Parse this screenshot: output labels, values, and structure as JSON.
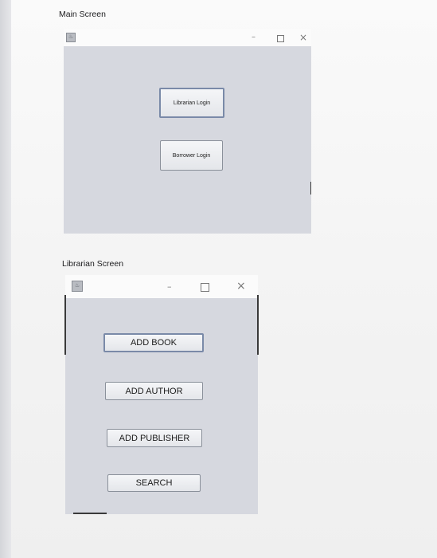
{
  "main_screen": {
    "caption": "Main Screen",
    "buttons": {
      "librarian_login": "Librarian Login",
      "borrower_login": "Borrower Login"
    },
    "window_controls": {
      "minimize": "–",
      "close": "×"
    }
  },
  "librarian_screen": {
    "caption": "Librarian Screen",
    "buttons": {
      "add_book": "ADD BOOK",
      "add_author": "ADD AUTHOR",
      "add_publisher": "ADD PUBLISHER",
      "search": "SEARCH"
    },
    "window_controls": {
      "minimize": "–",
      "close": "×"
    }
  }
}
